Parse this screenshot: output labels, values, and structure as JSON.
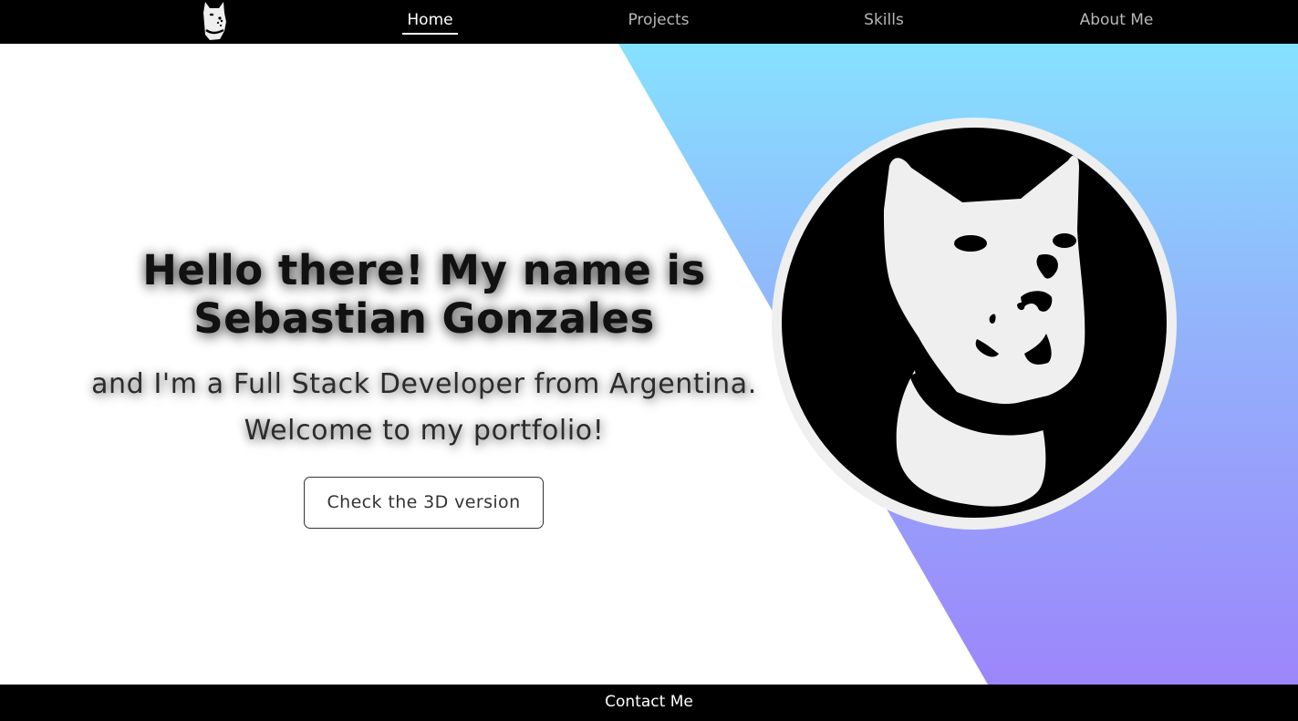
{
  "nav": {
    "logo_icon": "dog-face-logo-icon",
    "items": [
      {
        "label": "Home",
        "active": true
      },
      {
        "label": "Projects",
        "active": false
      },
      {
        "label": "Skills",
        "active": false
      },
      {
        "label": "About Me",
        "active": false
      }
    ]
  },
  "hero": {
    "title_line1": "Hello there! My name is",
    "title_line2": "Sebastian Gonzales",
    "subtitle_line1": "and I'm a Full Stack Developer from Argentina.",
    "subtitle_line2": "Welcome to my portfolio!",
    "cta_label": "Check the 3D version",
    "avatar_icon": "dog-avatar-icon"
  },
  "footer": {
    "contact_label": "Contact Me"
  },
  "colors": {
    "nav_bg": "#000000",
    "nav_active": "#ffffff",
    "nav_inactive": "#b8b8b8",
    "gradient_top": "#86e1ff",
    "gradient_bottom": "#9c86fb",
    "avatar_ring": "#efefef"
  }
}
